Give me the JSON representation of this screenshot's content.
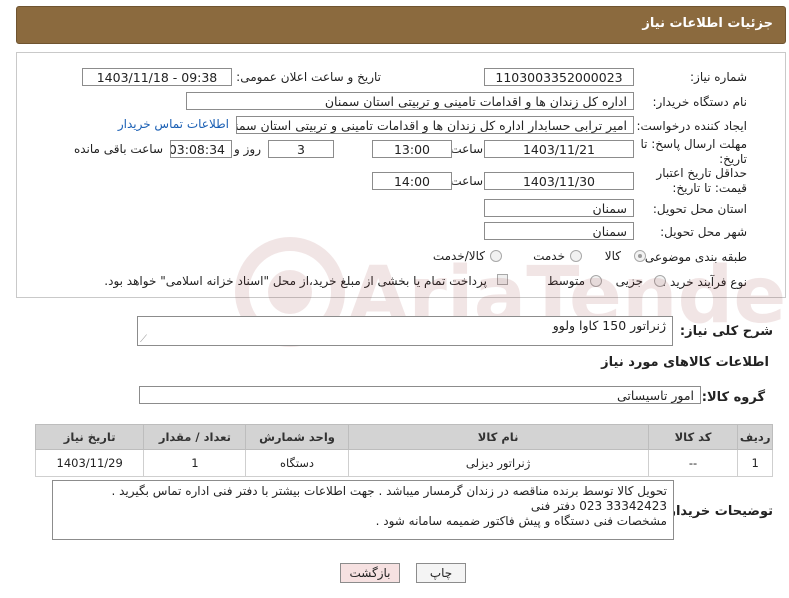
{
  "header": {
    "title": "جزئیات اطلاعات نیاز"
  },
  "form": {
    "need_number_label": "شماره نیاز:",
    "need_number": "1103003352000023",
    "announce_label": "تاریخ و ساعت اعلان عمومی:",
    "announce_value": "1403/11/18 - 09:38",
    "buyer_org_label": "نام دستگاه خریدار:",
    "buyer_org": "اداره کل زندان ها و اقدامات تامینی و تربیتی استان سمنان",
    "requester_label": "ایجاد کننده درخواست:",
    "requester": "امیر ترابی حسابدار اداره کل زندان ها و اقدامات تامینی و تربیتی استان سمنان",
    "contact_link": "اطلاعات تماس خریدار",
    "reply_deadline_label": "مهلت ارسال پاسخ: تا تاریخ:",
    "reply_date": "1403/11/21",
    "time_label": "ساعت",
    "reply_time": "13:00",
    "days_value": "3",
    "days_label": "روز و",
    "remaining_time": "03:08:34",
    "remaining_label": "ساعت باقی مانده",
    "price_validity_label": "حداقل تاریخ اعتبار قیمت: تا تاریخ:",
    "price_date": "1403/11/30",
    "price_time": "14:00",
    "province_label": "استان محل تحویل:",
    "province": "سمنان",
    "city_label": "شهر محل تحویل:",
    "city": "سمنان",
    "category_label": "طبقه بندی موضوعی:",
    "category_options": [
      "کالا",
      "خدمت",
      "کالا/خدمت"
    ],
    "process_label": "نوع فرآیند خرید :",
    "process_options": [
      "جزیی",
      "متوسط"
    ],
    "payment_note": "پرداخت تمام یا بخشی از مبلغ خرید،از محل \"اسناد خزانه اسلامی\" خواهد بود."
  },
  "summary": {
    "label": "شرح کلی نیاز:",
    "value": "ژنراتور 150 کاوا   ولوو"
  },
  "goods": {
    "section_title": "اطلاعات کالاهای مورد نیاز",
    "group_label": "گروه کالا:",
    "group_value": "امور تاسیساتی",
    "columns": [
      "ردیف",
      "کد کالا",
      "نام کالا",
      "واحد شمارش",
      "تعداد / مقدار",
      "تاریخ نیاز"
    ],
    "rows": [
      {
        "row": "1",
        "code": "--",
        "name": "ژنراتور دیزلی",
        "unit": "دستگاه",
        "qty": "1",
        "date": "1403/11/29"
      }
    ]
  },
  "buyer_notes": {
    "label": "توضیحات خریدار:",
    "lines": [
      "تحویل کالا توسط برنده مناقصه در زندان گرمسار میباشد . جهت اطلاعات بیشتر با دفتر فنی اداره تماس بگیرید .",
      "33342423    023  دفتر فنی",
      "مشخصات فنی دستگاه و پیش فاکتور ضمیمه سامانه شود ."
    ]
  },
  "buttons": {
    "print": "چاپ",
    "back": "بازگشت"
  },
  "colors": {
    "header_bg": "#8b6a3e",
    "table_header_bg": "#d3d3d3",
    "back_button_bg": "#f6e1e1"
  }
}
